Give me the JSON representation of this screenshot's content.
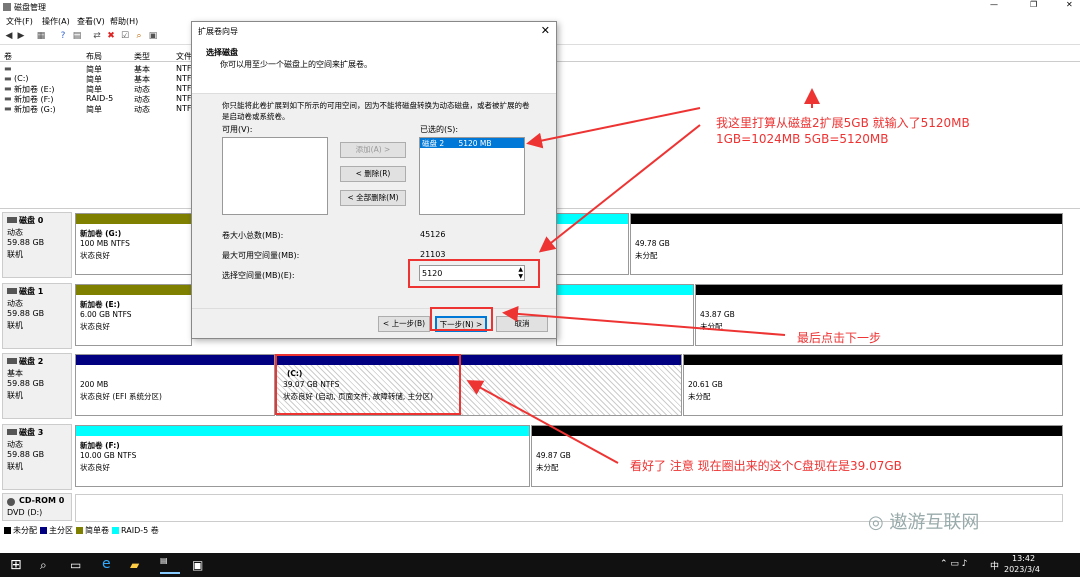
{
  "window": {
    "title": "磁盘管理",
    "menu": [
      "文件(F)",
      "操作(A)",
      "查看(V)",
      "帮助(H)"
    ]
  },
  "columns": [
    "卷",
    "布局",
    "类型",
    "文件"
  ],
  "volumes": [
    {
      "name": "",
      "layout": "简单",
      "type": "基本",
      "fs": "NTF"
    },
    {
      "name": "(C:)",
      "layout": "简单",
      "type": "基本",
      "fs": "NTF"
    },
    {
      "name": "新加卷 (E:)",
      "layout": "简单",
      "type": "动态",
      "fs": "NTF"
    },
    {
      "name": "新加卷 (F:)",
      "layout": "RAID-5",
      "type": "动态",
      "fs": "NTF"
    },
    {
      "name": "新加卷 (G:)",
      "layout": "简单",
      "type": "动态",
      "fs": "NTF"
    }
  ],
  "disks": [
    {
      "name": "磁盘 0",
      "type": "动态",
      "size": "59.88 GB",
      "status": "联机",
      "p1": {
        "name": "新加卷 (G:)",
        "info": "100 MB NTFS",
        "state": "状态良好"
      },
      "p2": {
        "size": "49.78 GB",
        "state": "未分配"
      }
    },
    {
      "name": "磁盘 1",
      "type": "动态",
      "size": "59.88 GB",
      "status": "联机",
      "p1": {
        "name": "新加卷 (E:)",
        "info": "6.00 GB NTFS",
        "state": "状态良好"
      },
      "p2": {
        "size": "43.87 GB",
        "state": "未分配"
      }
    },
    {
      "name": "磁盘 2",
      "type": "基本",
      "size": "59.88 GB",
      "status": "联机",
      "p1": {
        "info": "200 MB",
        "state": "状态良好 (EFI 系统分区)"
      },
      "pc": {
        "name": "(C:)",
        "info": "39.07 GB NTFS",
        "state": "状态良好 (启动, 页面文件, 故障转储, 主分区)"
      },
      "p2": {
        "size": "20.61 GB",
        "state": "未分配"
      }
    },
    {
      "name": "磁盘 3",
      "type": "动态",
      "size": "59.88 GB",
      "status": "联机",
      "p1": {
        "name": "新加卷 (F:)",
        "info": "10.00 GB NTFS",
        "state": "状态良好"
      },
      "p2": {
        "size": "49.87 GB",
        "state": "未分配"
      }
    },
    {
      "name": "CD-ROM 0",
      "type": "DVD (D:)",
      "size": "",
      "status": ""
    }
  ],
  "legend": [
    "未分配",
    "主分区",
    "简单卷",
    "RAID-5 卷"
  ],
  "dialog": {
    "title": "扩展卷向导",
    "head_title": "选择磁盘",
    "head_sub": "你可以用至少一个磁盘上的空间来扩展卷。",
    "desc": "你只能将此卷扩展到如下所示的可用空间，因为不能将磁盘转换为动态磁盘，或者被扩展的卷是启动卷或系统卷。",
    "available_label": "可用(V):",
    "selected_label": "已选的(S):",
    "selected_item": "磁盘 2      5120 MB",
    "add": "添加(A) >",
    "remove": "< 删除(R)",
    "remove_all": "< 全部删除(M)",
    "total_label": "卷大小总数(MB):",
    "total": "45126",
    "max_label": "最大可用空间量(MB):",
    "max": "21103",
    "select_label": "选择空间量(MB)(E):",
    "select_value": "5120",
    "back": "< 上一步(B)",
    "next": "下一步(N) >",
    "cancel": "取消"
  },
  "annotations": {
    "a1": "我这里打算从磁盘2扩展5GB 就输入了5120MB",
    "a2": "1GB=1024MB  5GB=5120MB",
    "a3": "最后点击下一步",
    "a4": "看好了 注意 现在圈出来的这个C盘现在是39.07GB"
  },
  "watermark": "遨游互联网",
  "clock": {
    "time": "13:42",
    "date": "2023/3/4"
  },
  "tray": "中",
  "colors": {
    "unalloc": "#000000",
    "primary": "#000080",
    "simple": "#808000",
    "raid": "#00ffff",
    "annot": "#e33333"
  }
}
